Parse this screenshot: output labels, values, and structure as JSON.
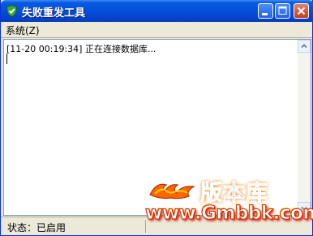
{
  "window": {
    "title": "失败重发工具",
    "icon": "shield-check-icon"
  },
  "titlebar_buttons": {
    "minimize": "minimize-icon",
    "maximize": "maximize-icon",
    "close": "close-icon"
  },
  "menubar": {
    "items": [
      {
        "label": "系统(Z)"
      }
    ]
  },
  "log": {
    "lines": [
      "[11-20 00:19:34] 正在连接数据库..."
    ]
  },
  "statusbar": {
    "text": "状态：已启用"
  },
  "watermark": {
    "brand_cn": "版本库",
    "url": "www.Gmbbk.com",
    "colors": {
      "accent": "#ff6600",
      "outline": "#cc2200"
    }
  },
  "colors": {
    "titlebar": "#0453dd",
    "window_bg": "#ece9d8",
    "log_border": "#7f9db9",
    "close_button": "#c93b1c"
  }
}
